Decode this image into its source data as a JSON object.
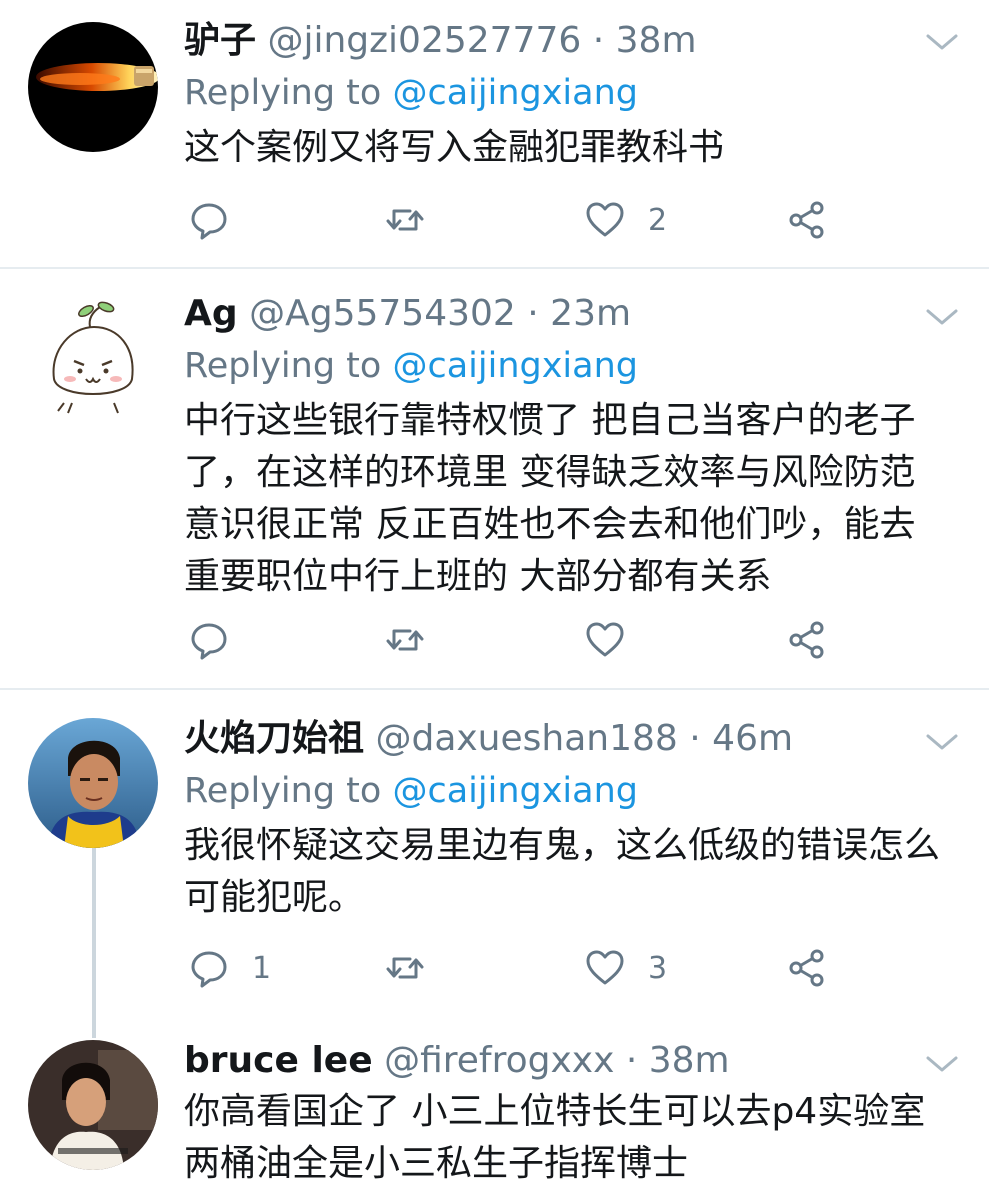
{
  "tweets": [
    {
      "name": "驴子",
      "handle": "@jingzi02527776",
      "time": "38m",
      "replying_prefix": "Replying to ",
      "replying_to": "@caijingxiang",
      "lines": [
        "这个案例又将写入金融犯罪教科书"
      ],
      "reply_count": "",
      "retweet_count": "",
      "like_count": "2"
    },
    {
      "name": "Ag",
      "handle": "@Ag55754302",
      "time": "23m",
      "replying_prefix": "Replying to ",
      "replying_to": "@caijingxiang",
      "lines": [
        "中行这些银行靠特权惯了 把自己当客户的老子",
        "了，在这样的环境里 变得缺乏效率与风险防范",
        "意识很正常 反正百姓也不会去和他们吵，能去",
        "重要职位中行上班的 大部分都有关系"
      ],
      "reply_count": "",
      "retweet_count": "",
      "like_count": ""
    },
    {
      "name": "火焰刀始祖",
      "handle": "@daxueshan188",
      "time": "46m",
      "replying_prefix": "Replying to ",
      "replying_to": "@caijingxiang",
      "lines": [
        "我很怀疑这交易里边有鬼，这么低级的错误怎么",
        "可能犯呢。"
      ],
      "reply_count": "1",
      "retweet_count": "",
      "like_count": "3"
    },
    {
      "name": "bruce lee",
      "handle": "@firefrogxxx",
      "time": "38m",
      "lines": [
        "你高看国企了 小三上位特长生可以去p4实验室",
        "两桶油全是小三私生子指挥博士"
      ]
    }
  ],
  "separator": "·",
  "icons": {
    "reply": "reply-icon",
    "retweet": "retweet-icon",
    "like": "heart-icon",
    "share": "share-icon",
    "more": "chevron-down-icon"
  },
  "colors": {
    "text": "#14171a",
    "secondary": "#657786",
    "link": "#1b95e0",
    "divider": "#e6ecf0"
  }
}
